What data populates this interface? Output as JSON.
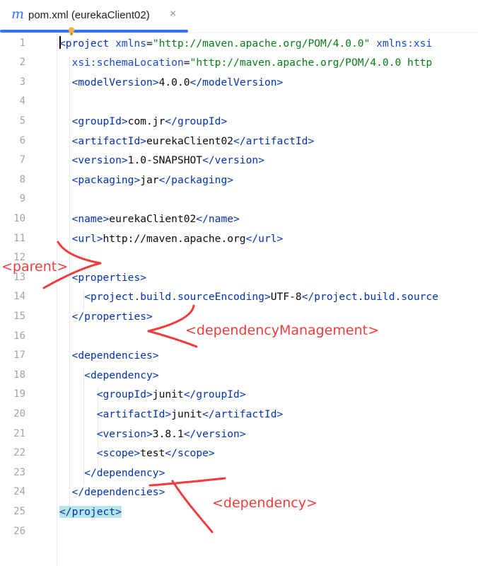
{
  "tab": {
    "file_icon": "m",
    "title": "pom.xml (eurekaClient02)",
    "close_icon": "×"
  },
  "lines": [
    {
      "n": "1",
      "segs": [
        [
          "tg",
          "<project"
        ],
        [
          "tx",
          " "
        ],
        [
          "at",
          "xmlns"
        ],
        [
          "tx",
          "="
        ],
        [
          "av",
          "\"http://maven.apache.org/POM/4.0.0\""
        ],
        [
          "tx",
          " "
        ],
        [
          "at",
          "xmlns:xsi"
        ]
      ]
    },
    {
      "n": "2",
      "segs": [
        [
          "tx",
          "  "
        ],
        [
          "at",
          "xsi:schemaLocation"
        ],
        [
          "tx",
          "="
        ],
        [
          "av",
          "\"http://maven.apache.org/POM/4.0.0 http"
        ]
      ]
    },
    {
      "n": "3",
      "segs": [
        [
          "tx",
          "  "
        ],
        [
          "tg",
          "<modelVersion>"
        ],
        [
          "tx",
          "4.0.0"
        ],
        [
          "tg",
          "</modelVersion>"
        ]
      ]
    },
    {
      "n": "4",
      "segs": []
    },
    {
      "n": "5",
      "segs": [
        [
          "tx",
          "  "
        ],
        [
          "tg",
          "<groupId>"
        ],
        [
          "tx",
          "com.jr"
        ],
        [
          "tg",
          "</groupId>"
        ]
      ]
    },
    {
      "n": "6",
      "segs": [
        [
          "tx",
          "  "
        ],
        [
          "tg",
          "<artifactId>"
        ],
        [
          "tx",
          "eurekaClient02"
        ],
        [
          "tg",
          "</artifactId>"
        ]
      ]
    },
    {
      "n": "7",
      "segs": [
        [
          "tx",
          "  "
        ],
        [
          "tg",
          "<version>"
        ],
        [
          "tx",
          "1.0-SNAPSHOT"
        ],
        [
          "tg",
          "</version>"
        ]
      ]
    },
    {
      "n": "8",
      "segs": [
        [
          "tx",
          "  "
        ],
        [
          "tg",
          "<packaging>"
        ],
        [
          "tx",
          "jar"
        ],
        [
          "tg",
          "</packaging>"
        ]
      ]
    },
    {
      "n": "9",
      "segs": []
    },
    {
      "n": "10",
      "segs": [
        [
          "tx",
          "  "
        ],
        [
          "tg",
          "<name>"
        ],
        [
          "tx",
          "eurekaClient02"
        ],
        [
          "tg",
          "</name>"
        ]
      ]
    },
    {
      "n": "11",
      "segs": [
        [
          "tx",
          "  "
        ],
        [
          "tg",
          "<url>"
        ],
        [
          "tx",
          "http://maven.apache.org"
        ],
        [
          "tg",
          "</url>"
        ]
      ]
    },
    {
      "n": "12",
      "segs": []
    },
    {
      "n": "13",
      "segs": [
        [
          "tx",
          "  "
        ],
        [
          "tg",
          "<properties>"
        ]
      ]
    },
    {
      "n": "14",
      "segs": [
        [
          "tx",
          "    "
        ],
        [
          "tg",
          "<project.build.sourceEncoding>"
        ],
        [
          "tx",
          "UTF-8"
        ],
        [
          "tg",
          "</project.build.source"
        ]
      ]
    },
    {
      "n": "15",
      "segs": [
        [
          "tx",
          "  "
        ],
        [
          "tg",
          "</properties>"
        ]
      ]
    },
    {
      "n": "16",
      "segs": []
    },
    {
      "n": "17",
      "segs": [
        [
          "tx",
          "  "
        ],
        [
          "tg",
          "<dependencies>"
        ]
      ]
    },
    {
      "n": "18",
      "segs": [
        [
          "tx",
          "    "
        ],
        [
          "tg",
          "<dependency>"
        ]
      ]
    },
    {
      "n": "19",
      "segs": [
        [
          "tx",
          "      "
        ],
        [
          "tg",
          "<groupId>"
        ],
        [
          "tx",
          "junit"
        ],
        [
          "tg",
          "</groupId>"
        ]
      ]
    },
    {
      "n": "20",
      "segs": [
        [
          "tx",
          "      "
        ],
        [
          "tg",
          "<artifactId>"
        ],
        [
          "tx",
          "junit"
        ],
        [
          "tg",
          "</artifactId>"
        ]
      ]
    },
    {
      "n": "21",
      "segs": [
        [
          "tx",
          "      "
        ],
        [
          "tg",
          "<version>"
        ],
        [
          "tx",
          "3.8.1"
        ],
        [
          "tg",
          "</version>"
        ]
      ]
    },
    {
      "n": "22",
      "segs": [
        [
          "tx",
          "      "
        ],
        [
          "tg",
          "<scope>"
        ],
        [
          "tx",
          "test"
        ],
        [
          "tg",
          "</scope>"
        ]
      ]
    },
    {
      "n": "23",
      "segs": [
        [
          "tx",
          "    "
        ],
        [
          "tg",
          "</dependency>"
        ]
      ]
    },
    {
      "n": "24",
      "segs": [
        [
          "tx",
          "  "
        ],
        [
          "tg",
          "</dependencies>"
        ]
      ]
    },
    {
      "n": "25",
      "segs": [
        [
          "tg",
          "</project>"
        ]
      ]
    },
    {
      "n": "26",
      "segs": []
    }
  ],
  "annotations": {
    "parent": "<parent>",
    "dependency_management": "<dependencyManagement>",
    "dependency": "<dependency>"
  },
  "colors": {
    "tag": "#0033b3",
    "attribute": "#174ad4",
    "attribute_value": "#067d17",
    "text": "#080808",
    "annotation": "#f03c3c",
    "accent": "#3574f0"
  }
}
